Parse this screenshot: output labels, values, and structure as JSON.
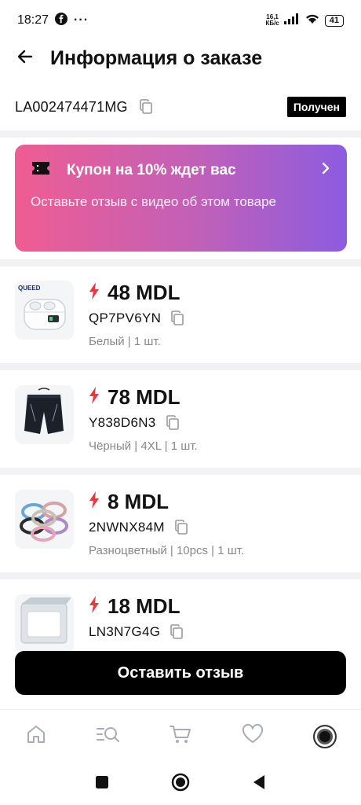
{
  "status_bar": {
    "time": "18:27",
    "notification_dots": "···",
    "net_speed_value": "16,1",
    "net_speed_unit": "КБ/с",
    "battery": "41"
  },
  "header": {
    "title": "Информация о заказе"
  },
  "order": {
    "id": "LA002474471MG",
    "status": "Получен"
  },
  "coupon": {
    "title": "Купон на 10% ждет вас",
    "subtitle": "Оставьте отзыв с видео об этом товаре"
  },
  "items": [
    {
      "price": "48 MDL",
      "sku": "QP7PV6YN",
      "variant": "Белый | 1 шт.",
      "thumb": "earbuds",
      "brand": "QUEED"
    },
    {
      "price": "78 MDL",
      "sku": "Y838D6N3",
      "variant": "Чёрный | 4XL | 1 шт.",
      "thumb": "shorts"
    },
    {
      "price": "8 MDL",
      "sku": "2NWNX84M",
      "variant": "Разноцветный | 10pcs | 1 шт.",
      "thumb": "hair-ties"
    },
    {
      "price": "18 MDL",
      "sku": "LN3N7G4G",
      "variant": "",
      "thumb": "box"
    }
  ],
  "actions": {
    "review_button": "Оставить отзыв"
  },
  "bottom_nav": [
    "home-icon",
    "search-list-icon",
    "cart-icon",
    "heart-icon",
    "avatar"
  ],
  "colors": {
    "accent_red": "#e8383d",
    "coupon_gradient_start": "#ef5d92",
    "coupon_gradient_end": "#8c5ce0",
    "badge_bg": "#000000",
    "muted_text": "#888888"
  }
}
